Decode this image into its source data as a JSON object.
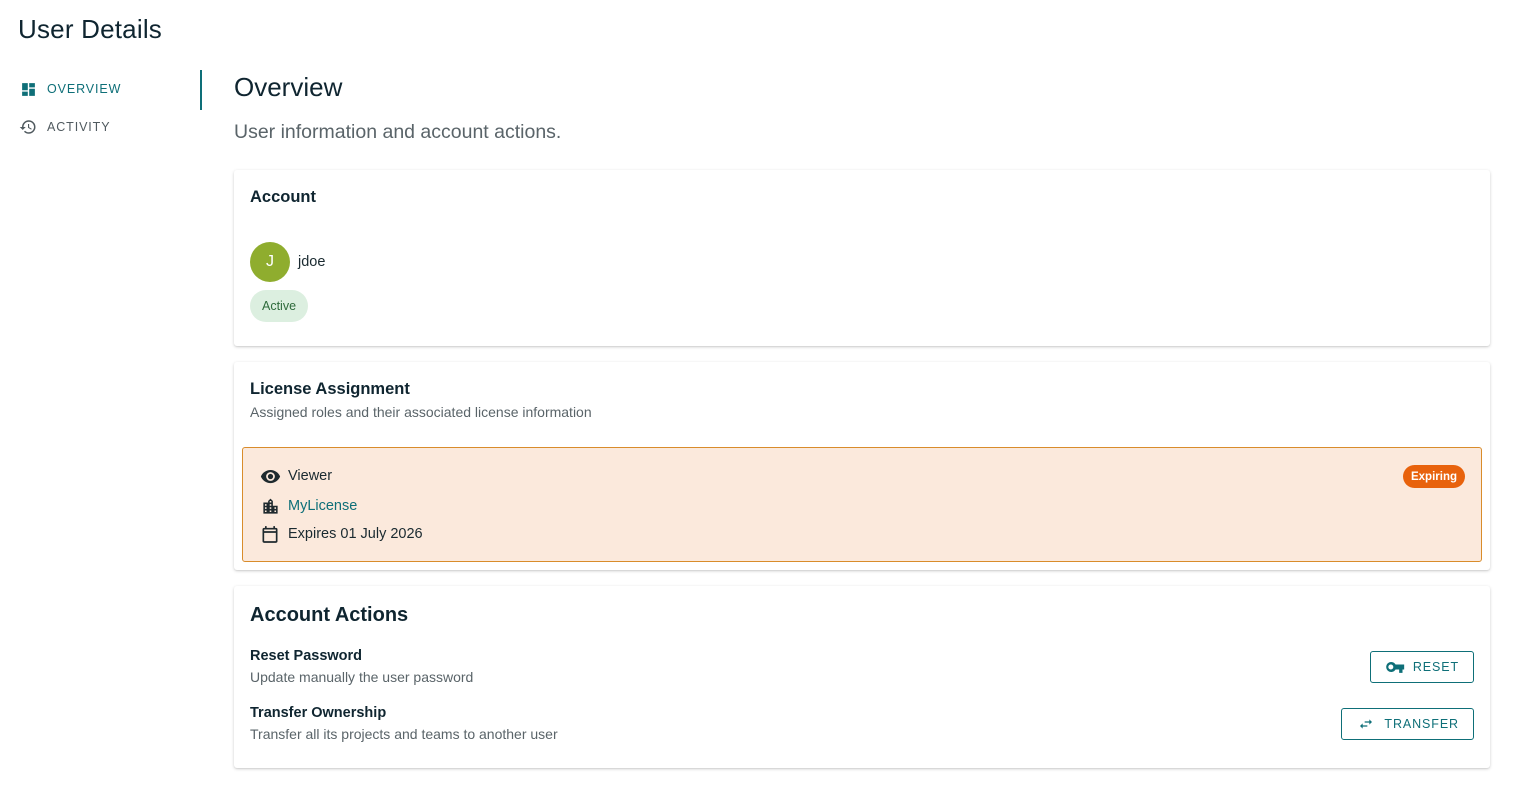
{
  "page": {
    "title": "User Details"
  },
  "sidebar": {
    "items": [
      {
        "label": "OVERVIEW",
        "icon": "dashboard-icon",
        "active": true
      },
      {
        "label": "ACTIVITY",
        "icon": "history-icon",
        "active": false
      }
    ]
  },
  "main": {
    "title": "Overview",
    "subtitle": "User information and account actions."
  },
  "account": {
    "title": "Account",
    "avatar_initial": "J",
    "username": "jdoe",
    "status": "Active"
  },
  "license": {
    "title": "License Assignment",
    "description": "Assigned roles and their associated license information",
    "role": "Viewer",
    "license_name": "MyLicense",
    "expiry": "Expires 01 July 2026",
    "badge": "Expiring"
  },
  "actions": {
    "title": "Account Actions",
    "items": [
      {
        "name": "Reset Password",
        "description": "Update manually the user password",
        "button": "RESET",
        "icon": "key-icon"
      },
      {
        "name": "Transfer Ownership",
        "description": "Transfer all its projects and teams to another user",
        "button": "TRANSFER",
        "icon": "swap-arrows-icon"
      }
    ]
  },
  "colors": {
    "accent": "#0e6f78",
    "avatar": "#8fad2e",
    "active_badge_bg": "#dcefe0",
    "license_bg": "#fbe9dc",
    "license_border": "#d98c2b",
    "expiring_badge": "#e8620c"
  }
}
